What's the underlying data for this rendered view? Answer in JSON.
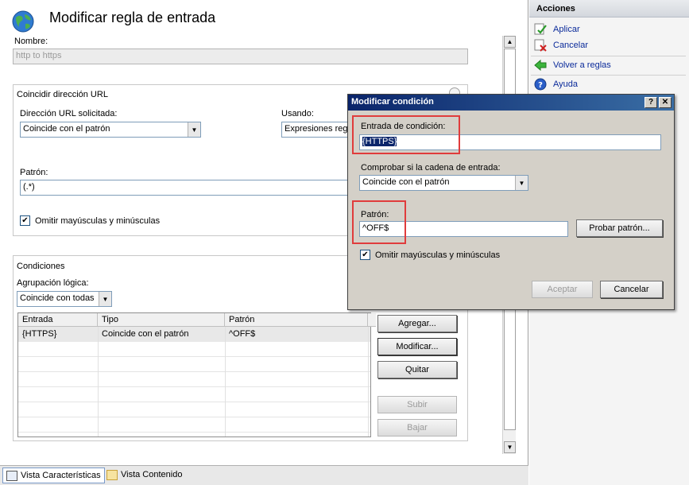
{
  "page": {
    "title": "Modificar regla de entrada"
  },
  "name_section": {
    "label": "Nombre:",
    "value": "http to https"
  },
  "match_url": {
    "group_label": "Coincidir dirección URL",
    "requested_label": "Dirección URL solicitada:",
    "requested_value": "Coincide con el patrón",
    "using_label": "Usando:",
    "using_value": "Expresiones reg",
    "pattern_label": "Patrón:",
    "pattern_value": "(.*)",
    "ignore_case_label": "Omitir mayúsculas y minúsculas",
    "ignore_case_checked": "✔"
  },
  "conditions": {
    "group_label": "Condiciones",
    "grouping_label": "Agrupación lógica:",
    "grouping_value": "Coincide con todas",
    "columns": [
      "Entrada",
      "Tipo",
      "Patrón"
    ],
    "rows": [
      [
        "{HTTPS}",
        "Coincide con el patrón",
        "^OFF$"
      ]
    ],
    "buttons": {
      "add": "Agregar...",
      "edit": "Modificar...",
      "remove": "Quitar",
      "up": "Subir",
      "down": "Bajar"
    }
  },
  "actions": {
    "header": "Acciones",
    "items": [
      {
        "label": "Aplicar",
        "icon": "apply-icon"
      },
      {
        "label": "Cancelar",
        "icon": "cancel-icon"
      },
      {
        "label": "Volver a reglas",
        "icon": "back-arrow-icon"
      },
      {
        "label": "Ayuda",
        "icon": "help-icon"
      }
    ]
  },
  "footer": {
    "features_view": "Vista Características",
    "content_view": "Vista Contenido"
  },
  "dialog": {
    "title": "Modificar condición",
    "help_btn": "?",
    "close_btn": "✕",
    "input_label": "Entrada de condición:",
    "input_value": "{HTTPS}",
    "check_label": "Comprobar si la cadena de entrada:",
    "check_value": "Coincide con el patrón",
    "pattern_label": "Patrón:",
    "pattern_value": "^OFF$",
    "test_button": "Probar patrón...",
    "ignore_case_label": "Omitir mayúsculas y minúsculas",
    "ignore_case_checked": "✔",
    "ok_button": "Aceptar",
    "cancel_button": "Cancelar"
  },
  "colors": {
    "highlight": "#e03c3c",
    "titlebar": "#0a246a",
    "link": "#0a2a9a"
  }
}
